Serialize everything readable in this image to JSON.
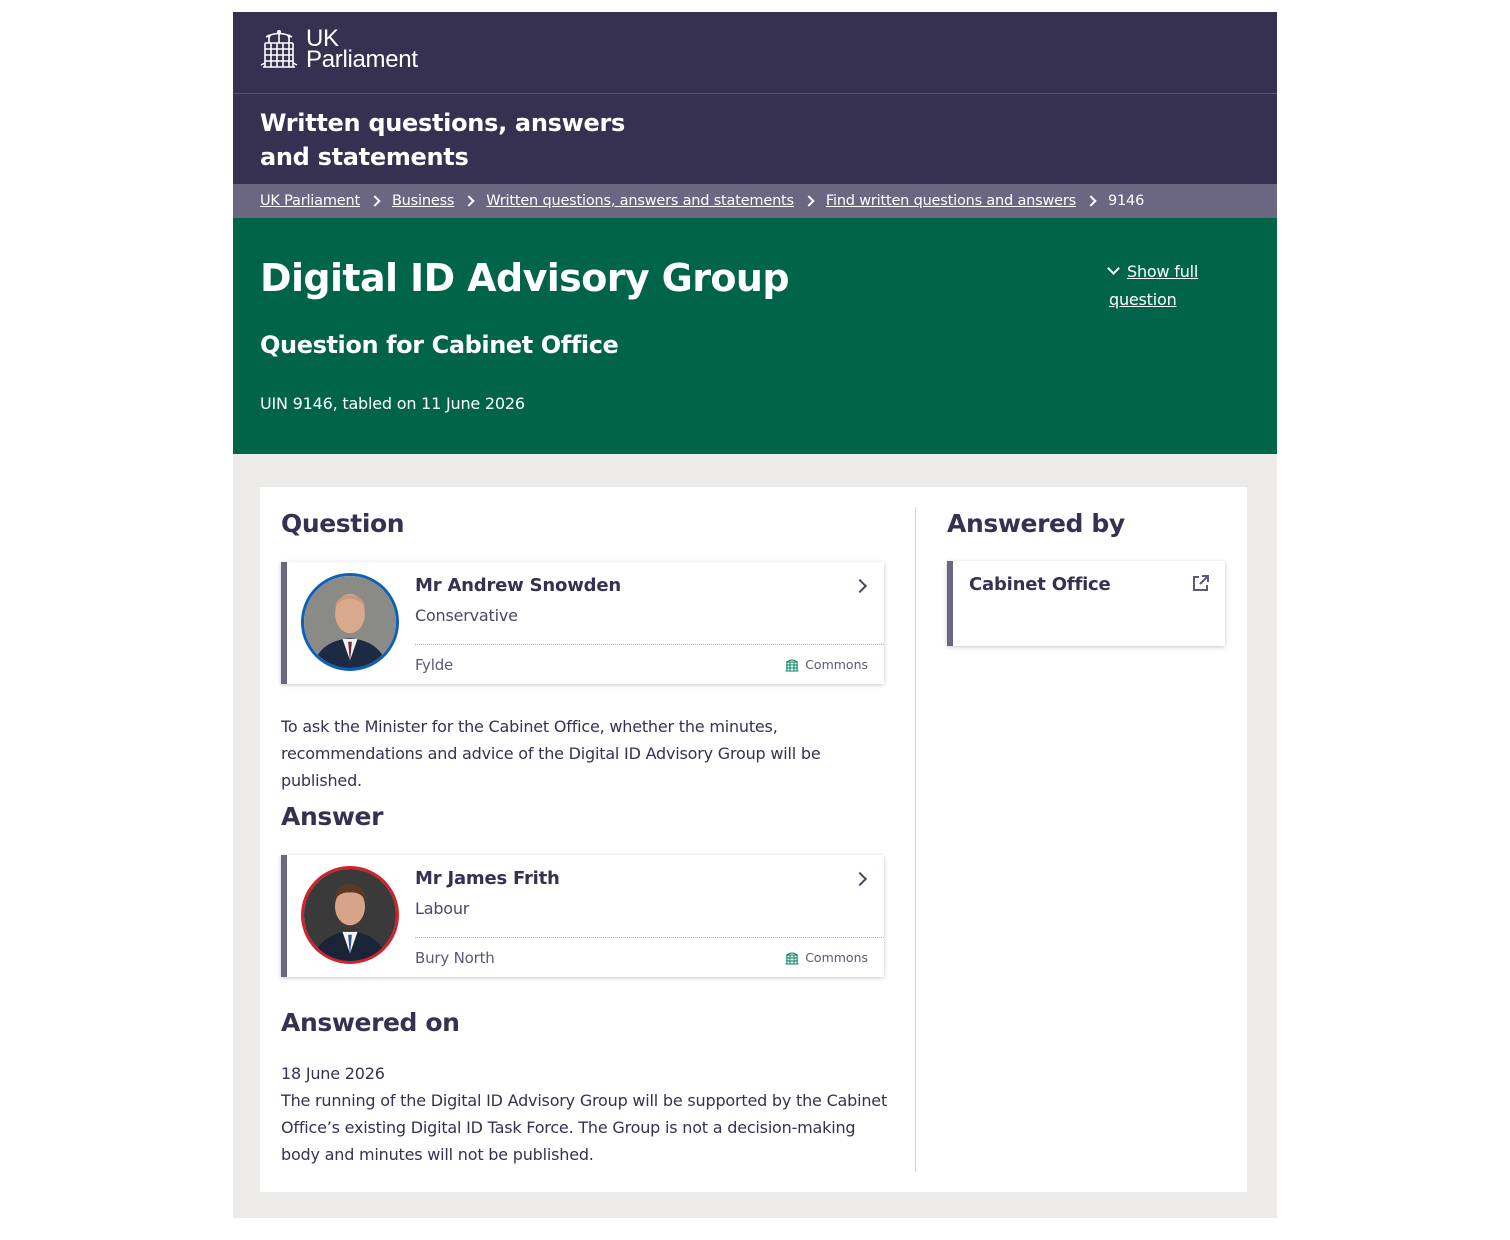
{
  "header": {
    "logo_line1": "UK",
    "logo_line2": "Parliament",
    "section_title": "Written questions, answers and statements"
  },
  "breadcrumbs": {
    "items": [
      "UK Parliament",
      "Business",
      "Written questions, answers and statements",
      "Find written questions and answers"
    ],
    "current": "9146"
  },
  "hero": {
    "title": "Digital ID Advisory Group",
    "subtitle": "Question for Cabinet Office",
    "uin": "UIN 9146, tabled on 11 June 2026",
    "show_full_line1": "Show full",
    "show_full_line2": "question"
  },
  "question": {
    "heading": "Question",
    "member": {
      "name": "Mr Andrew Snowden",
      "party": "Conservative",
      "constituency": "Fylde",
      "house": "Commons",
      "party_color": "#0f5fb9"
    },
    "text": "To ask the Minister for the Cabinet Office, whether the minutes, recommendations and advice of the Digital ID Advisory Group will be published."
  },
  "answer": {
    "heading": "Answer",
    "member": {
      "name": "Mr James Frith",
      "party": "Labour",
      "constituency": "Bury North",
      "house": "Commons",
      "party_color": "#d3202b"
    }
  },
  "answered_on": {
    "heading": "Answered on",
    "date": "18 June 2026",
    "text": "The running of the Digital ID Advisory Group will be supported by the Cabinet Office’s existing Digital ID Task Force. The Group is not a decision-making body and minutes will not be published."
  },
  "answered_by": {
    "heading": "Answered by",
    "department": "Cabinet Office"
  },
  "colors": {
    "brand_purple": "#373151",
    "breadcrumb_bg": "#6b6682",
    "hero_green": "#006548",
    "page_bg": "#edebea"
  }
}
